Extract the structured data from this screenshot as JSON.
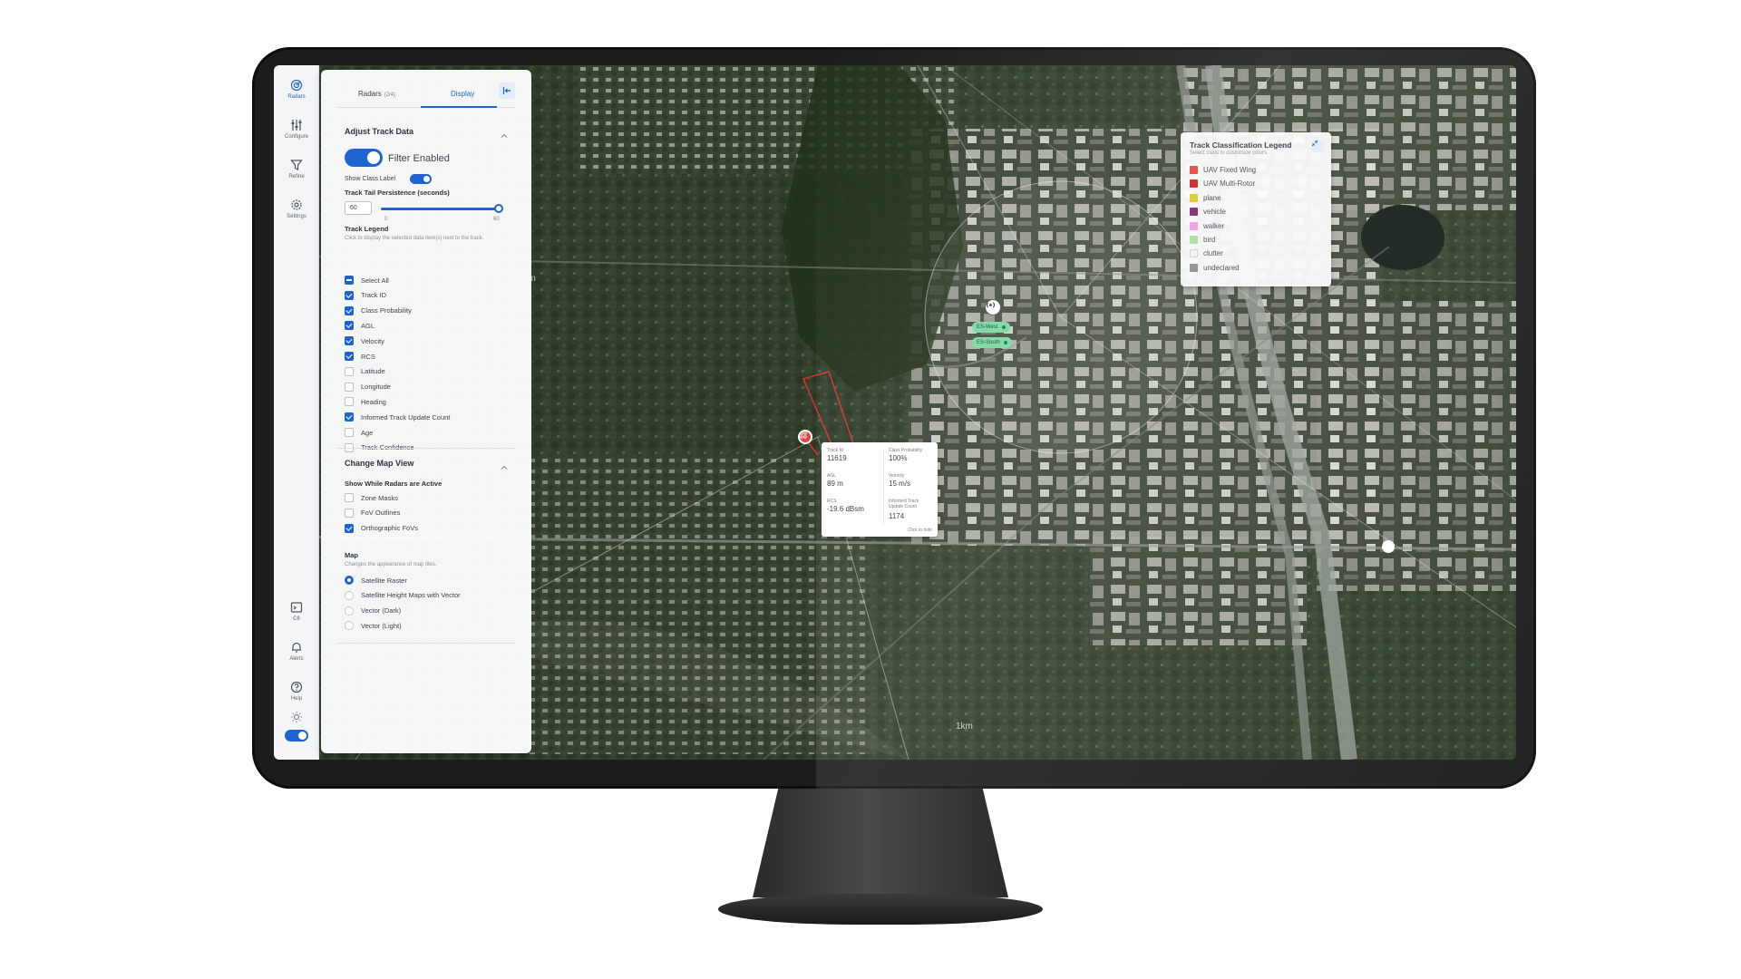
{
  "rail": {
    "items": [
      {
        "label": "Radars",
        "icon": "radar-icon",
        "active": true
      },
      {
        "label": "Configure",
        "icon": "sliders-icon",
        "active": false
      },
      {
        "label": "Refine",
        "icon": "filter-icon",
        "active": false
      },
      {
        "label": "Settings",
        "icon": "gear-icon",
        "active": false
      },
      {
        "label": "C6",
        "icon": "terminal-icon",
        "active": false
      },
      {
        "label": "Alerts",
        "icon": "bell-icon",
        "active": false
      },
      {
        "label": "Help",
        "icon": "help-icon",
        "active": false
      }
    ]
  },
  "panel": {
    "tabs": [
      {
        "label": "Radars",
        "count": "(2/4)"
      },
      {
        "label": "Display",
        "count": ""
      }
    ],
    "adjust_title": "Adjust Track Data",
    "filter_label": "Filter Enabled",
    "show_class_label": "Show Class Label",
    "persistence_title": "Track Tail Persistence (seconds)",
    "persistence_value": "60",
    "slider_min": "0",
    "slider_max": "60",
    "legend_title": "Track Legend",
    "legend_hint": "Click to display the selected data item(s) next to the track.",
    "track_items": [
      {
        "label": "Select All",
        "state": "partial"
      },
      {
        "label": "Track ID",
        "state": "on"
      },
      {
        "label": "Class Probability",
        "state": "on"
      },
      {
        "label": "AGL",
        "state": "on"
      },
      {
        "label": "Velocity",
        "state": "on"
      },
      {
        "label": "RCS",
        "state": "on"
      },
      {
        "label": "Latitude",
        "state": "off"
      },
      {
        "label": "Longitude",
        "state": "off"
      },
      {
        "label": "Heading",
        "state": "off"
      },
      {
        "label": "Informed Track Update Count",
        "state": "on"
      },
      {
        "label": "Age",
        "state": "off"
      },
      {
        "label": "Track Confidence",
        "state": "off"
      }
    ],
    "map_view_title": "Change Map View",
    "show_while_title": "Show While Radars are Active",
    "show_while_items": [
      {
        "label": "Zone Masks",
        "state": "off"
      },
      {
        "label": "FoV Outlines",
        "state": "off"
      },
      {
        "label": "Orthographic FoVs",
        "state": "on"
      }
    ],
    "map_title": "Map",
    "map_hint": "Changes the appearance of map tiles.",
    "map_options": [
      {
        "label": "Satellite Raster",
        "selected": true
      },
      {
        "label": "Satellite Height Maps with Vector",
        "selected": false
      },
      {
        "label": "Vector (Dark)",
        "selected": false
      },
      {
        "label": "Vector (Light)",
        "selected": false
      }
    ]
  },
  "map": {
    "scale_labels": [
      "1km",
      "1km"
    ],
    "radar_tags": [
      "ES-West",
      "ES-South"
    ],
    "radar_count": "2"
  },
  "popup": {
    "fields": [
      {
        "label": "Track Id",
        "value": "11619"
      },
      {
        "label": "Class Probability",
        "value": "100%"
      },
      {
        "label": "AGL",
        "value": "89 m"
      },
      {
        "label": "Velocity",
        "value": "15 m/s"
      },
      {
        "label": "RCS",
        "value": "-19.6 dBsm"
      },
      {
        "label": "Informed Track Update Count",
        "value": "1174"
      }
    ],
    "close_hint": "Click to hide"
  },
  "legend": {
    "title": "Track Classification Legend",
    "hint": "Select class to customize colors.",
    "items": [
      {
        "label": "UAV Fixed Wing",
        "color": "#e8413a"
      },
      {
        "label": "UAV Multi-Rotor",
        "color": "#c81e1e"
      },
      {
        "label": "plane",
        "color": "#d8c81e"
      },
      {
        "label": "vehicle",
        "color": "#7a1e6e"
      },
      {
        "label": "walker",
        "color": "#f09ae6"
      },
      {
        "label": "bird",
        "color": "#a6dca2"
      },
      {
        "label": "clutter",
        "color": "#f2f2f2"
      },
      {
        "label": "undeclared",
        "color": "#8a8a8a"
      }
    ]
  },
  "colors": {
    "accent": "#1f63d1",
    "track": "#e0463c",
    "radar_tag": "#7bd7a5"
  }
}
